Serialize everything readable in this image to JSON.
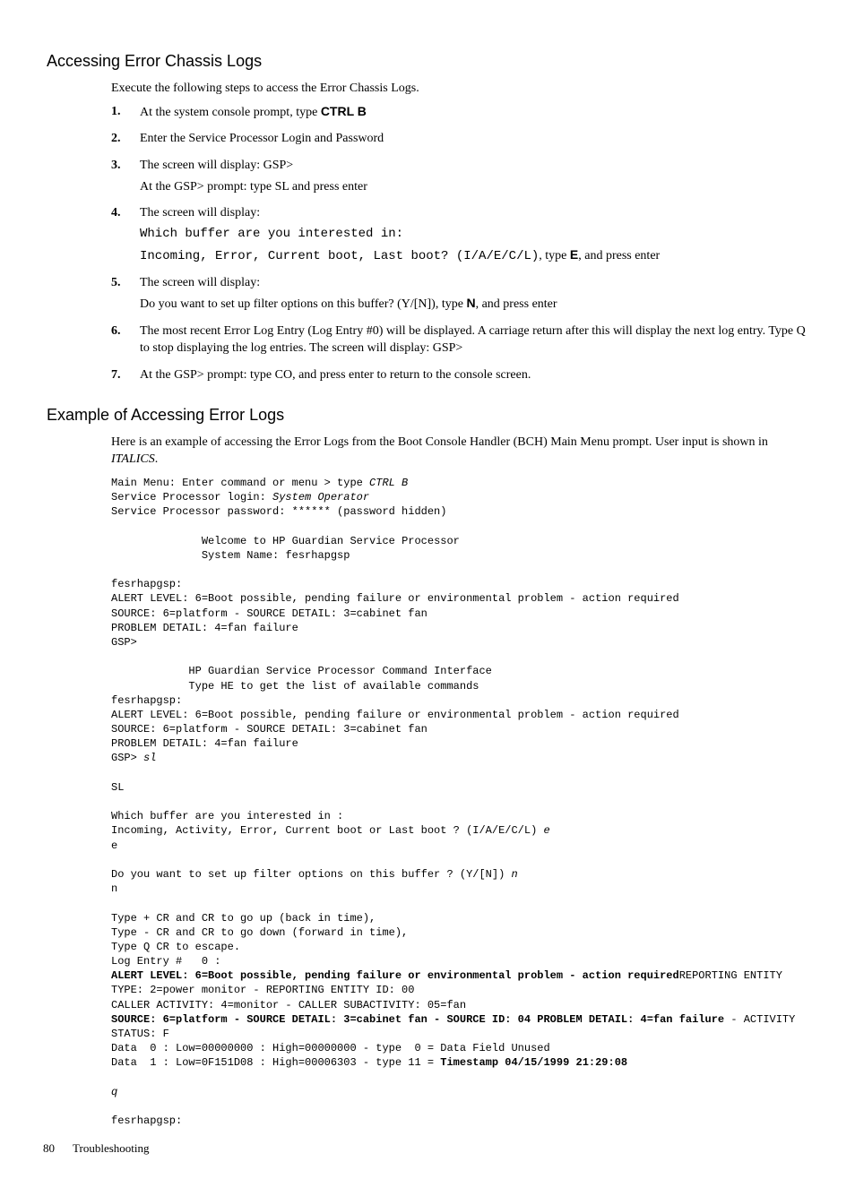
{
  "section1": {
    "heading": "Accessing Error Chassis Logs",
    "intro": "Execute the following steps to access the Error Chassis Logs.",
    "step1": {
      "num": "1.",
      "text_a": "At the system console prompt, type ",
      "kbd": "CTRL B"
    },
    "step2": {
      "num": "2.",
      "text": "Enter the Service Processor Login and Password"
    },
    "step3": {
      "num": "3.",
      "line1": "The screen will display: GSP>",
      "line2": "At the GSP> prompt: type SL and press enter"
    },
    "step4": {
      "num": "4.",
      "line1": "The screen will display:",
      "mono1": "Which buffer are you interested in:",
      "mono2a": "Incoming, Error, Current boot, Last boot? (I/A/E/C/L)",
      "text2b": ", type ",
      "kbd2": "E",
      "text2c": ", and press enter"
    },
    "step5": {
      "num": "5.",
      "line1": "The screen will display:",
      "line2a": "Do you want to set up filter options on this buffer? (Y/[N]), type ",
      "kbd": "N",
      "line2b": ", and press enter"
    },
    "step6": {
      "num": "6.",
      "text": "The most recent Error Log Entry (Log Entry #0) will be displayed. A carriage return after this will display the next log entry. Type Q to stop displaying the log entries. The screen will display: GSP>"
    },
    "step7": {
      "num": "7.",
      "text": "At the GSP> prompt: type CO, and press enter to return to the console screen."
    }
  },
  "section2": {
    "heading": "Example of Accessing Error Logs",
    "intro_a": "Here is an example of accessing the Error Logs from the Boot Console Handler (BCH) Main Menu prompt. User input is shown in ",
    "intro_italic": "ITALICS",
    "intro_b": ".",
    "term": {
      "l1a": "Main Menu: Enter command or menu > type ",
      "l1i": "CTRL B",
      "l2a": "Service Processor login: ",
      "l2i": "System Operator",
      "l3": "Service Processor password: ****** (password hidden)",
      "l4": "",
      "l5": "              Welcome to HP Guardian Service Processor",
      "l6": "              System Name: fesrhapgsp",
      "l7": "",
      "l8": "fesrhapgsp:",
      "l9": "ALERT LEVEL: 6=Boot possible, pending failure or environmental problem - action required",
      "l10": "SOURCE: 6=platform - SOURCE DETAIL: 3=cabinet fan",
      "l11": "PROBLEM DETAIL: 4=fan failure",
      "l12": "GSP>",
      "l13": "",
      "l14": "            HP Guardian Service Processor Command Interface",
      "l15": "            Type HE to get the list of available commands",
      "l16": "fesrhapgsp:",
      "l17": "ALERT LEVEL: 6=Boot possible, pending failure or environmental problem - action required",
      "l18": "SOURCE: 6=platform - SOURCE DETAIL: 3=cabinet fan",
      "l19": "PROBLEM DETAIL: 4=fan failure",
      "l20a": "GSP> ",
      "l20i": "sl",
      "l21": "",
      "l22": "SL",
      "l23": "",
      "l24": "Which buffer are you interested in :",
      "l25a": "Incoming, Activity, Error, Current boot or Last boot ? (I/A/E/C/L) ",
      "l25i": "e",
      "l26": "e",
      "l27": "",
      "l28a": "Do you want to set up filter options on this buffer ? (Y/[N]) ",
      "l28i": "n",
      "l29": "n",
      "l30": "",
      "l31": "Type + CR and CR to go up (back in time),",
      "l32": "Type - CR and CR to go down (forward in time),",
      "l33": "Type Q CR to escape.",
      "l34": "Log Entry #   0 :",
      "l35b": "ALERT LEVEL: 6=Boot possible, pending failure or environmental problem - action required",
      "l35c": "REPORTING ENTITY TYPE: 2=power monitor - REPORTING ENTITY ID: 00",
      "l36": "CALLER ACTIVITY: 4=monitor - CALLER SUBACTIVITY: 05=fan",
      "l37b": "SOURCE: 6=platform - SOURCE DETAIL: 3=cabinet fan - SOURCE ID: 04 PROBLEM DETAIL: 4=fan failure",
      "l37c": " - ACTIVITY STATUS: F",
      "l38": "Data  0 : Low=00000000 : High=00000000 - type  0 = Data Field Unused",
      "l39a": "Data  1 : Low=0F151D08 : High=00006303 - type 11 = ",
      "l39b": "Timestamp 04/15/1999 21:29:08",
      "l40": "",
      "l41i": "q",
      "l42": "",
      "l43": "fesrhapgsp:"
    }
  },
  "footer": {
    "page": "80",
    "chapter": "Troubleshooting"
  }
}
